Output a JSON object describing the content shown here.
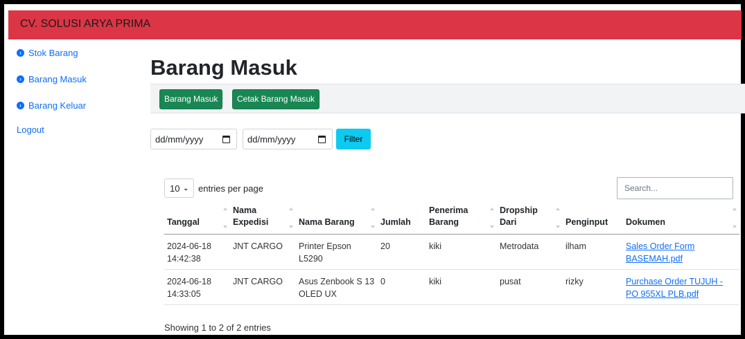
{
  "app": {
    "brand": "CV. SOLUSI ARYA PRIMA"
  },
  "sidebar": {
    "items": [
      {
        "label": "Stok Barang"
      },
      {
        "label": "Barang Masuk"
      },
      {
        "label": "Barang Keluar"
      }
    ],
    "logout": "Logout"
  },
  "page": {
    "title": "Barang Masuk"
  },
  "toolbar": {
    "btn_barang_masuk": "Barang Masuk",
    "btn_cetak": "Cetak Barang Masuk"
  },
  "filter": {
    "date_from_placeholder": "dd/mm/yyyy",
    "date_to_placeholder": "dd/mm/yyyy",
    "button": "Filter"
  },
  "table_controls": {
    "per_page_value": "10",
    "per_page_label": "entries per page",
    "search_placeholder": "Search..."
  },
  "table": {
    "headers": [
      "Tanggal",
      "Nama Expedisi",
      "Nama Barang",
      "Jumlah",
      "Penerima Barang",
      "Dropship Dari",
      "Penginput",
      "Dokumen"
    ],
    "rows": [
      {
        "tanggal": "2024-06-18 14:42:38",
        "expedisi": "JNT CARGO",
        "barang": "Printer Epson L5290",
        "jumlah": "20",
        "penerima": "kiki",
        "dropship": "Metrodata",
        "penginput": "ilham",
        "dokumen": "Sales Order Form BASEMAH.pdf"
      },
      {
        "tanggal": "2024-06-18 14:33:05",
        "expedisi": "JNT CARGO",
        "barang": "Asus Zenbook S 13 OLED UX",
        "jumlah": "0",
        "penerima": "kiki",
        "dropship": "pusat",
        "penginput": "rizky",
        "dokumen": "Purchase Order TUJUH - PO 955XL PLB.pdf"
      }
    ]
  },
  "footer": {
    "info": "Showing 1 to 2 of 2 entries"
  },
  "colors": {
    "topbar": "#dc3545",
    "link": "#0d6efd",
    "success": "#198754",
    "info": "#0dcaf0"
  }
}
